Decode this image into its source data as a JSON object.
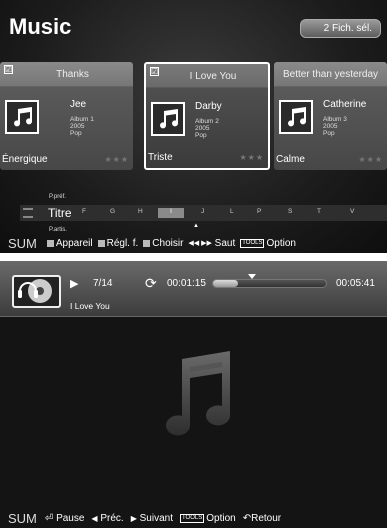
{
  "browser": {
    "title": "Music",
    "selected_button": "2 Fich. sél.",
    "cards": [
      {
        "title": "Thanks",
        "artist": "Jee",
        "album": "Album 1",
        "year": "2005",
        "genre": "Pop",
        "mood": "Énergique",
        "checked": true,
        "selected": false
      },
      {
        "title": "I Love You",
        "artist": "Darby",
        "album": "Album 2",
        "year": "2005",
        "genre": "Pop",
        "mood": "Triste",
        "checked": true,
        "selected": true
      },
      {
        "title": "Better than yesterday",
        "artist": "Catherine",
        "album": "Album 3",
        "year": "2005",
        "genre": "Pop",
        "mood": "Calme",
        "checked": false,
        "selected": false
      }
    ],
    "stars": "★★★",
    "checkmark": "☑",
    "sort": {
      "prev": "P.préf.",
      "current": "Titre",
      "next": "P.artis."
    },
    "letters": [
      "F",
      "G",
      "H",
      "I",
      "J",
      "L",
      "P",
      "S",
      "T",
      "V"
    ],
    "active_letter_index": 3,
    "caret": "▲",
    "bar": {
      "sum": "SUM",
      "device": "Appareil",
      "settings": "Régl. f.",
      "choose": "Choisir",
      "skip_icon": "◀◀ ▶▶",
      "skip": "Saut",
      "tools": "TOOLS",
      "option": "Option"
    }
  },
  "player": {
    "play_icon": "▶",
    "track": "7/14",
    "repeat_icon": "⟳",
    "elapsed": "00:01:15",
    "total": "00:05:41",
    "progress": 0.22,
    "now_playing": "I Love You",
    "bar": {
      "sum": "SUM",
      "pause_icon": "⏎",
      "pause": "Pause",
      "prev_icon": "◀",
      "prev": "Préc.",
      "next_icon": "▶",
      "next": "Suivant",
      "tools": "TOOLS",
      "option": "Option",
      "back_icon": "↶",
      "back": "Retour"
    }
  }
}
